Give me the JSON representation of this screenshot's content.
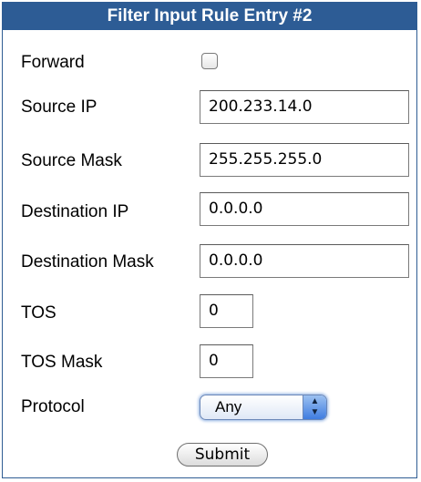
{
  "header": {
    "title": "Filter Input Rule Entry #2"
  },
  "fields": {
    "forward": {
      "label": "Forward",
      "checked": false
    },
    "source_ip": {
      "label": "Source IP",
      "value": "200.233.14.0"
    },
    "source_mask": {
      "label": "Source Mask",
      "value": "255.255.255.0"
    },
    "destination_ip": {
      "label": "Destination IP",
      "value": "0.0.0.0"
    },
    "destination_mask": {
      "label": "Destination Mask",
      "value": "0.0.0.0"
    },
    "tos": {
      "label": "TOS",
      "value": "0"
    },
    "tos_mask": {
      "label": "TOS Mask",
      "value": "0"
    },
    "protocol": {
      "label": "Protocol",
      "value": "Any"
    }
  },
  "actions": {
    "submit_label": "Submit"
  },
  "colors": {
    "header_bg": "#2d5c95",
    "header_text": "#ffffff",
    "border": "#2f5d93",
    "focus_glow": "#8fb1e2"
  }
}
